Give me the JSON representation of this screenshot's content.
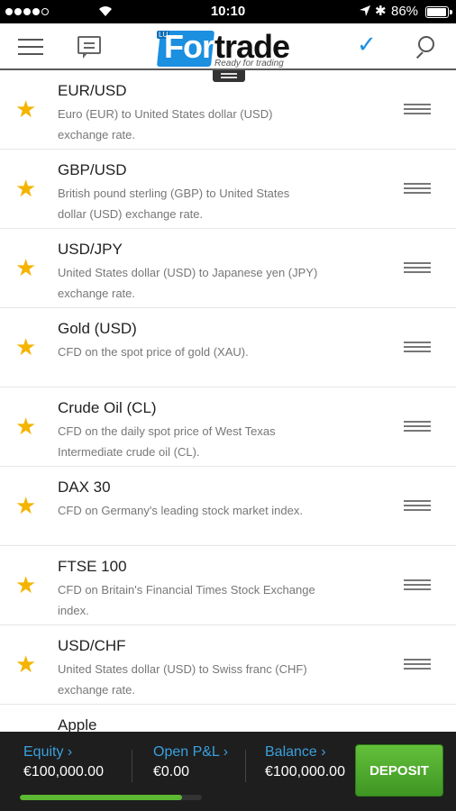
{
  "status_bar": {
    "time": "10:10",
    "battery_text": "86%",
    "battery_level": 0.86
  },
  "header": {
    "logo_badge": "LU",
    "logo_for": "For",
    "logo_trade": "trade",
    "logo_tagline": "Ready for trading"
  },
  "instruments": [
    {
      "name": "EUR/USD",
      "desc": "Euro (EUR) to United States dollar (USD) exchange rate."
    },
    {
      "name": "GBP/USD",
      "desc": "British pound sterling (GBP) to United States dollar (USD) exchange rate."
    },
    {
      "name": "USD/JPY",
      "desc": "United States dollar (USD) to Japanese yen (JPY) exchange rate."
    },
    {
      "name": "Gold (USD)",
      "desc": "CFD on the spot price of gold (XAU)."
    },
    {
      "name": "Crude Oil (CL)",
      "desc": "CFD on the daily spot price of West Texas Intermediate crude oil (CL)."
    },
    {
      "name": "DAX 30",
      "desc": "CFD on Germany's leading stock market index."
    },
    {
      "name": "FTSE 100",
      "desc": "CFD on Britain's Financial Times Stock Exchange index."
    },
    {
      "name": "USD/CHF",
      "desc": "United States dollar (USD) to Swiss franc (CHF) exchange rate."
    },
    {
      "name": "Apple",
      "desc": ""
    }
  ],
  "bottom_bar": {
    "equity_label": "Equity",
    "equity_value": "€100,000.00",
    "pnl_label": "Open P&L",
    "pnl_value": "€0.00",
    "balance_label": "Balance",
    "balance_value": "€100,000.00",
    "margin_level": 0.89,
    "deposit_label": "DEPOSIT"
  },
  "colors": {
    "accent": "#1b8fe0",
    "star": "#f4b400",
    "deposit": "#4fae2c"
  }
}
